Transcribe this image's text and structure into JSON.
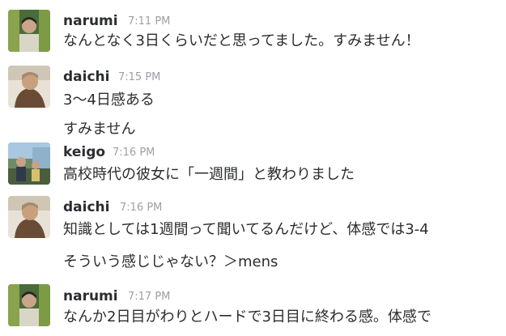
{
  "messages": [
    {
      "user": "narumi",
      "time": "7:11 PM",
      "avatar": "narumi-avatar",
      "lines": [
        "なんとなく3日くらいだと思ってました。すみません！"
      ]
    },
    {
      "user": "daichi",
      "time": "7:15 PM",
      "avatar": "daichi-avatar",
      "lines": [
        "3〜4日感ある",
        "すみません"
      ]
    },
    {
      "user": "keigo",
      "time": "7:16 PM",
      "avatar": "keigo-avatar",
      "lines": [
        "高校時代の彼女に「一週間」と教わりました"
      ]
    },
    {
      "user": "daichi",
      "time": "7:16 PM",
      "avatar": "daichi-avatar",
      "lines": [
        "知識としては1週間って聞いてるんだけど、体感では3-4",
        "そういう感じじゃない？＞mens"
      ]
    },
    {
      "user": "narumi",
      "time": "7:17 PM",
      "avatar": "narumi-avatar",
      "lines": [
        "なんか2日目がわりとハードで3日目に終わる感。体感で"
      ]
    }
  ]
}
